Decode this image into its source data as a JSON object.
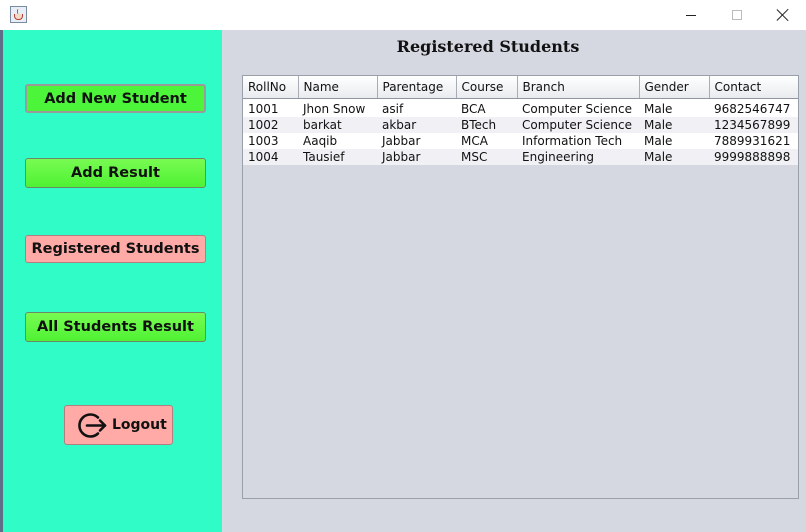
{
  "window": {
    "icons": [
      "java-cup-icon",
      "minimize-icon",
      "maximize-icon",
      "close-icon"
    ]
  },
  "sidebar": {
    "add_student_label": "Add New Student",
    "add_result_label": "Add Result",
    "registered_label": "Registered Students",
    "all_results_label": "All Students Result",
    "logout_label": "Logout",
    "colors": {
      "background": "#30fcc8",
      "button_green": "#4ff234",
      "button_pink": "#ffaaa6"
    }
  },
  "main": {
    "title": "Registered Students",
    "table": {
      "columns": [
        "RollNo",
        "Name",
        "Parentage",
        "Course",
        "Branch",
        "Gender",
        "Contact"
      ],
      "rows": [
        [
          "1001",
          "Jhon Snow",
          "asif",
          "BCA",
          "Computer Science",
          "Male",
          "9682546747"
        ],
        [
          "1002",
          "barkat",
          "akbar",
          "BTech",
          "Computer Science",
          "Male",
          "1234567899"
        ],
        [
          "1003",
          "Aaqib",
          "Jabbar",
          "MCA",
          "Information Tech",
          "Male",
          "7889931621"
        ],
        [
          "1004",
          "Tausief",
          "Jabbar",
          "MSC",
          "Engineering",
          "Male",
          "9999888898"
        ]
      ]
    }
  }
}
